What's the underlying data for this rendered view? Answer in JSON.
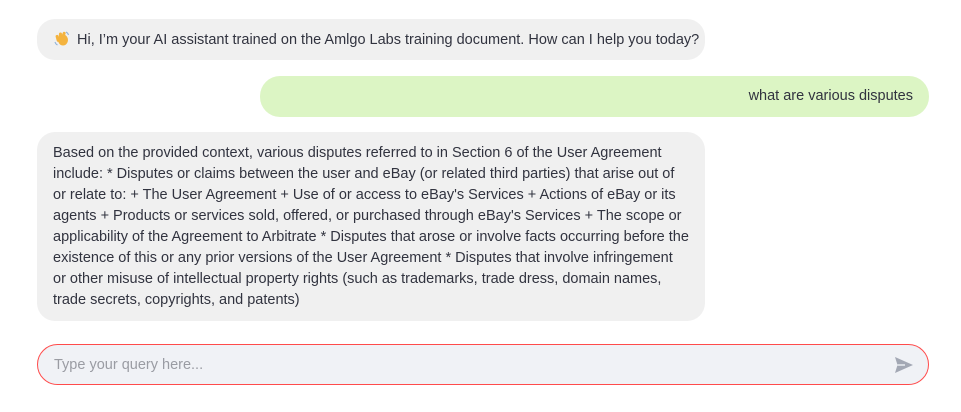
{
  "chat": {
    "messages": [
      {
        "role": "assistant",
        "icon": "waving-hand-icon",
        "text": "Hi, I’m your AI assistant trained on the Amlgo Labs training document. How can I help you today?"
      },
      {
        "role": "user",
        "text": "what are various disputes"
      },
      {
        "role": "assistant",
        "text": "Based on the provided context, various disputes referred to in Section 6 of the User Agreement include: * Disputes or claims between the user and eBay (or related third parties) that arise out of or relate to: + The User Agreement + Use of or access to eBay's Services + Actions of eBay or its agents + Products or services sold, offered, or purchased through eBay's Services + The scope or applicability of the Agreement to Arbitrate * Disputes that arose or involve facts occurring before the existence of this or any prior versions of the User Agreement * Disputes that involve infringement or other misuse of intellectual property rights (such as trademarks, trade dress, domain names, trade secrets, copyrights, and patents)"
      }
    ]
  },
  "input": {
    "placeholder": "Type your query here...",
    "value": ""
  },
  "colors": {
    "assistant_bubble": "#f0f0f0",
    "user_bubble": "#dcf5c4",
    "input_border": "#ff4b4b",
    "input_bg": "#f0f2f6",
    "text": "#31333f"
  }
}
